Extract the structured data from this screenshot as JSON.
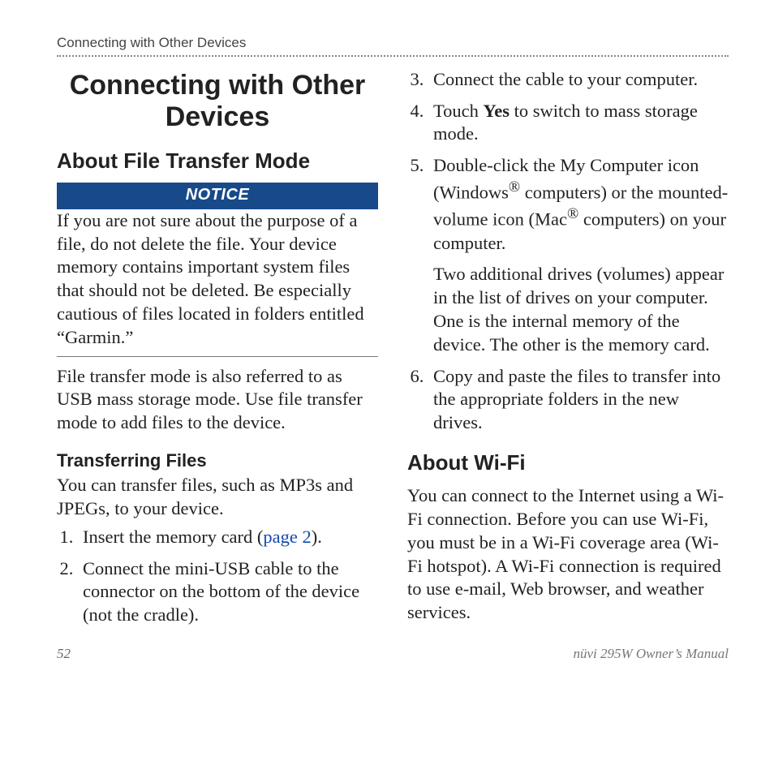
{
  "running_head": "Connecting with Other Devices",
  "chapter_title": "Connecting with Other Devices",
  "section_about_ftm_title": "About File Transfer Mode",
  "notice_label": "NOTICE",
  "notice_text": "If you are not sure about the purpose of a file, do not delete the file. Your device memory contains important system files that should not be deleted. Be especially cautious of files located in folders entitled “Garmin.”",
  "ftm_desc": "File transfer mode is also referred to as USB mass storage mode. Use file transfer mode to add files to the device.",
  "transferring_title": "Transferring Files",
  "transferring_intro": "You can transfer files, such as MP3s and JPEGs, to your device.",
  "steps": {
    "s1_pre": "Insert the memory card (",
    "s1_link": "page 2",
    "s1_post": ").",
    "s2": "Connect the mini-USB cable to the connector on the bottom of the device (not the cradle).",
    "s3": "Connect the cable to your computer.",
    "s4_pre": "Touch ",
    "s4_bold": "Yes",
    "s4_post": " to switch to mass storage mode.",
    "s5_a": "Double-click the My Computer icon (Windows",
    "s5_b": " computers) or the mounted-volume icon (Mac",
    "s5_c": " computers) on your computer.",
    "s5_sub": "Two additional drives (volumes) appear in the list of drives on your computer. One is the internal memory of the device. The other is the memory card.",
    "s6": "Copy and paste the files to transfer into the appropriate folders in the new drives."
  },
  "wifi_title": "About Wi-Fi",
  "wifi_text": "You can connect to the Internet using a Wi-Fi connection. Before you can use Wi-Fi, you must be in a Wi-Fi coverage area (Wi-Fi hotspot). A Wi-Fi connection is required to use e-mail, Web browser, and weather services.",
  "page_number": "52",
  "manual_name": "nüvi 295W Owner’s Manual",
  "reg_mark": "®"
}
